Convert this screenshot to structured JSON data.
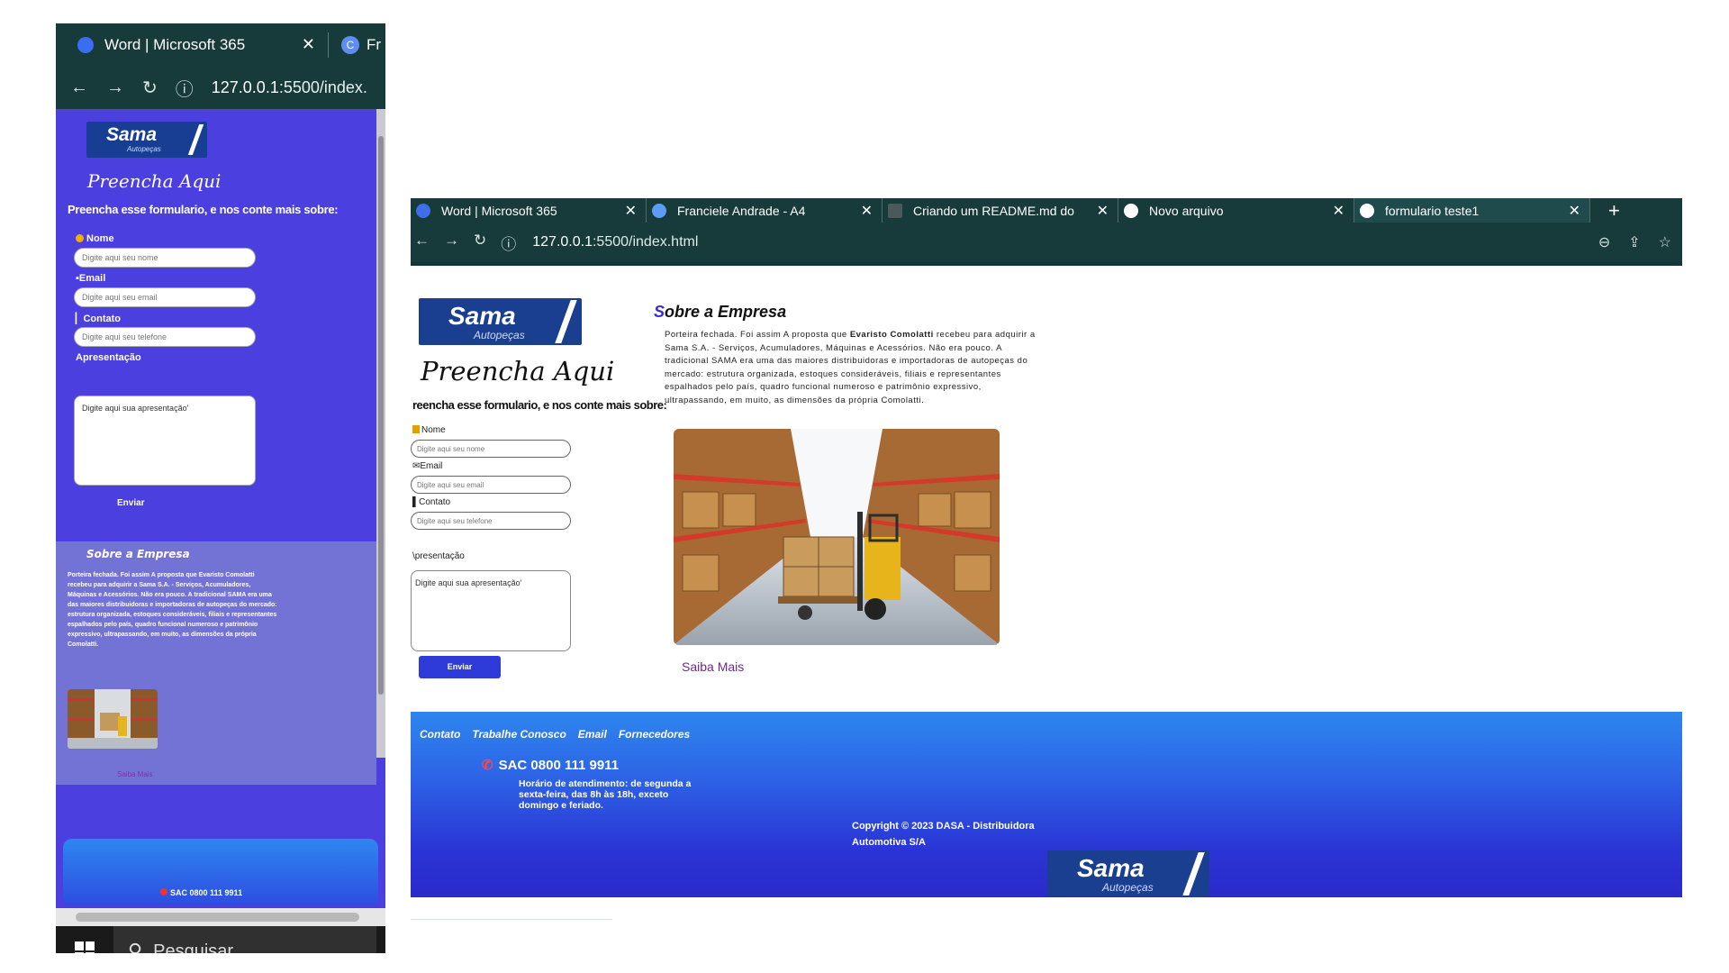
{
  "left_window": {
    "tab_title": "Word | Microsoft 365",
    "tab_close": "✕",
    "tab2_partial": "Fr",
    "url_host": "127.0.0.1",
    "url_rest": ":5500/index.",
    "logo_name": "Sama",
    "logo_sub": "Autopeças",
    "heading": "Preencha Aqui",
    "sub_heading": "Preencha esse formulario, e nos conte mais sobre:",
    "labels": {
      "nome": "Nome",
      "email": "Email",
      "contato": "Contato",
      "apresentacao": "Apresentação"
    },
    "placeholders": {
      "nome": "Digite aqui seu nome",
      "email": "Digite aqui seu email",
      "contato": "Digite aqui seu telefone",
      "apresentacao": "Digite aqui sua apresentação'"
    },
    "send": "Enviar",
    "about_title": "Sobre a Empresa",
    "about_text": "Porteira fechada. Foi assim A proposta que Evaristo Comolatti recebeu para adquirir a Sama S.A. - Serviços, Acumuladores, Máquinas e Acessórios. Não era pouco. A tradicional SAMA era uma das maiores distribuidoras e importadoras de autopeças do mercado: estrutura organizada, estoques consideráveis, filiais e representantes espalhados pelo país, quadro funcional numeroso e patrimônio expressivo, ultrapassando, em muito, as dimensões da própria Comolatti.",
    "more": "Saiba Mais",
    "sac": "SAC 0800 111 9911",
    "taskbar_search": "Pesquisar"
  },
  "right_window": {
    "tabs": [
      {
        "title": "Word | Microsoft 365",
        "color": "#3f6fe6"
      },
      {
        "title": "Franciele Andrade - A4",
        "color": "#5c9cf5"
      },
      {
        "title": "Criando um README.md do",
        "color": "#4a5a5a"
      },
      {
        "title": "Novo arquivo",
        "color": "#ffffff"
      },
      {
        "title": "formulario teste1",
        "color": "#ffffff"
      }
    ],
    "tab_close": "✕",
    "new_tab": "+",
    "url_host": "127.0.0.1",
    "url_rest": ":5500/index.html",
    "logo_name": "Sama",
    "logo_sub": "Autopeças",
    "heading": "Preencha Aqui",
    "sub_heading": "reencha esse formulario, e nos conte mais sobre:",
    "labels": {
      "nome": "Nome",
      "email": "Email",
      "contato": "Contato",
      "apresentacao": "\\presentação"
    },
    "placeholders": {
      "nome": "Digite aqui seu nome",
      "email": "Digite aqui seu email",
      "contato": "Digite aqui seu telefone",
      "apresentacao": "Digite aqui sua apresentação'"
    },
    "send": "Enviar",
    "about_title": "Sobre a Empresa",
    "about_text_1": "Porteira fechada. Foi assim A proposta que ",
    "about_text_bold": "Evaristo Comolatti",
    "about_text_2": " recebeu para adquirir a Sama S.A. - Serviços, Acumuladores, Máquinas e Acessórios. Não era pouco. A tradicional SAMA era uma das maiores distribuidoras e importadoras de autopeças do mercado: estrutura organizada, estoques consideráveis, filiais e representantes espalhados pelo país, quadro funcional numeroso e patrimônio expressivo, ultrapassando, em muito, as dimensões da própria Comolatti.",
    "more": "Saiba Mais",
    "footer": {
      "links": [
        "Contato",
        "Trabalhe Conosco",
        "Email",
        "Fornecedores"
      ],
      "sac": "SAC 0800 111 9911",
      "hours": "Horário de atendimento: de segunda a sexta-feira, das 8h às 18h, exceto domingo e feriado.",
      "copyright": "Copyright © 2023 DASA - Distribuidora Automotiva S/A",
      "logo_name": "Sama",
      "logo_sub": "Autopeças"
    }
  },
  "colors": {
    "browser_chrome": "#173a3b",
    "page_purple": "#4b3fe0",
    "logo_blue": "#1a3f90",
    "footer_blue": "#2d64e6"
  }
}
